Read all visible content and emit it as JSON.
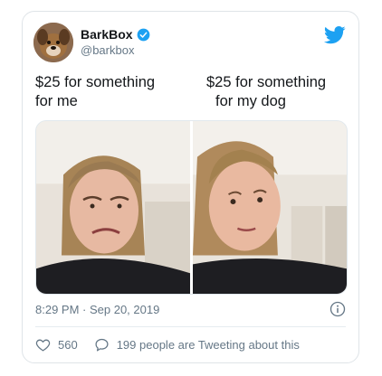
{
  "tweet": {
    "author_name": "BarkBox",
    "author_handle": "@barkbox",
    "verified": true,
    "caption_left_line1": "$25 for something",
    "caption_left_line2": "for me",
    "caption_right_line1": "$25 for something",
    "caption_right_line2": "for my dog",
    "timestamp": "8:29 PM · Sep 20, 2019",
    "likes": "560",
    "conversation_text": "199 people are Tweeting about this"
  },
  "icons": {
    "brand": "twitter-bird-icon",
    "verified": "verified-badge-icon",
    "info": "info-icon",
    "like": "heart-icon",
    "reply": "speech-bubble-icon"
  },
  "colors": {
    "brand_blue": "#1da1f2",
    "text_primary": "#14171a",
    "text_secondary": "#657786"
  }
}
